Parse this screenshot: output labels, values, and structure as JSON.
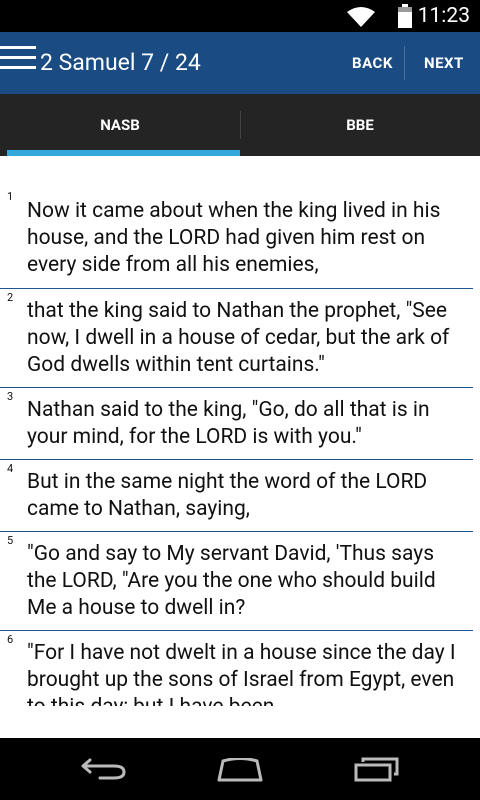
{
  "status": {
    "time": "11:23"
  },
  "header": {
    "title": "2 Samuel 7 / 24",
    "back_label": "BACK",
    "next_label": "NEXT"
  },
  "tabs": [
    {
      "label": "NASB",
      "selected": true
    },
    {
      "label": "BBE",
      "selected": false
    }
  ],
  "colors": {
    "actionbar": "#1a4b83",
    "tab_indicator": "#32a9d8",
    "tabs_bg": "#242424"
  },
  "verses": [
    {
      "num": "1",
      "text": "Now it came about when the king lived in his house, and the LORD had given him rest on every side from all his enemies,"
    },
    {
      "num": "2",
      "text": "that the king said to Nathan the prophet, \"See now, I dwell in a house of cedar, but the ark of God dwells within tent curtains.\""
    },
    {
      "num": "3",
      "text": "Nathan said to the king, \"Go, do all that is in your mind, for the LORD is with you.\""
    },
    {
      "num": "4",
      "text": "But in the same night the word of the LORD came to Nathan, saying,"
    },
    {
      "num": "5",
      "text": "\"Go and say to My servant David, 'Thus says the LORD, \"Are you the one who should build Me a house to dwell in?"
    },
    {
      "num": "6",
      "text": "\"For I have not dwelt in a house since the day I brought up the sons of Israel from Egypt, even to this day; but I have been"
    }
  ],
  "nav": {
    "back_icon": "back-icon",
    "home_icon": "home-icon",
    "recents_icon": "recents-icon"
  }
}
